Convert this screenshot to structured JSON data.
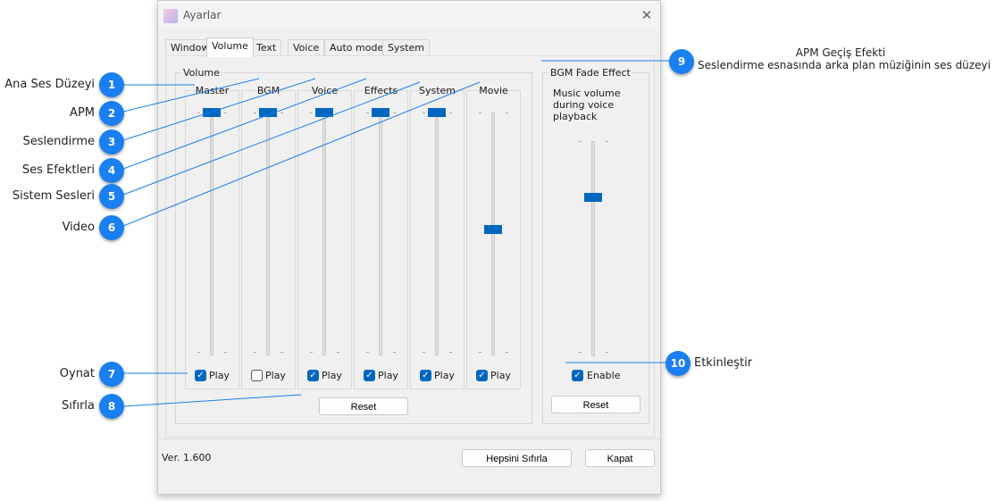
{
  "window": {
    "title": "Ayarlar",
    "close_glyph": "✕",
    "icon": "app-icon"
  },
  "tabs": [
    {
      "label": "Window"
    },
    {
      "label": "Volume",
      "active": true
    },
    {
      "label": "Text"
    },
    {
      "label": "Voice"
    },
    {
      "label": "Auto mode"
    },
    {
      "label": "System"
    }
  ],
  "volume_group": {
    "title": "Volume",
    "channels": [
      {
        "label": "Master",
        "level": 1.0,
        "play_label": "Play",
        "play_checked": true
      },
      {
        "label": "BGM",
        "level": 1.0,
        "play_label": "Play",
        "play_checked": false
      },
      {
        "label": "Voice",
        "level": 1.0,
        "play_label": "Play",
        "play_checked": true
      },
      {
        "label": "Effects",
        "level": 1.0,
        "play_label": "Play",
        "play_checked": true
      },
      {
        "label": "System",
        "level": 1.0,
        "play_label": "Play",
        "play_checked": true
      },
      {
        "label": "Movie",
        "level": 0.51,
        "play_label": "Play",
        "play_checked": true
      }
    ],
    "reset_label": "Reset"
  },
  "bgm_fade": {
    "title": "BGM Fade Effect",
    "description": [
      "Music volume",
      "during voice",
      "playback"
    ],
    "level": 0.75,
    "enable_label": "Enable",
    "enable_checked": true,
    "reset_label": "Reset"
  },
  "footer": {
    "version": "Ver. 1.600",
    "reset_all_label": "Hepsini Sıfırla",
    "close_label": "Kapat"
  },
  "annotations": [
    {
      "number": "1",
      "text": "Ana Ses Düzeyi"
    },
    {
      "number": "2",
      "text": "APM"
    },
    {
      "number": "3",
      "text": "Seslendirme"
    },
    {
      "number": "4",
      "text": "Ses Efektleri"
    },
    {
      "number": "5",
      "text": "Sistem Sesleri"
    },
    {
      "number": "6",
      "text": "Video"
    },
    {
      "number": "7",
      "text": "Oynat"
    },
    {
      "number": "8",
      "text": "Sıfırla"
    },
    {
      "number": "9",
      "text": "APM Geçiş Efekti",
      "subtext": "Seslendirme esnasında arka plan müziğinin ses düzeyi"
    },
    {
      "number": "10",
      "text": "Etkinleştir"
    }
  ],
  "colors": {
    "accent": "#0067c0",
    "badge": "#1a7ff0"
  }
}
